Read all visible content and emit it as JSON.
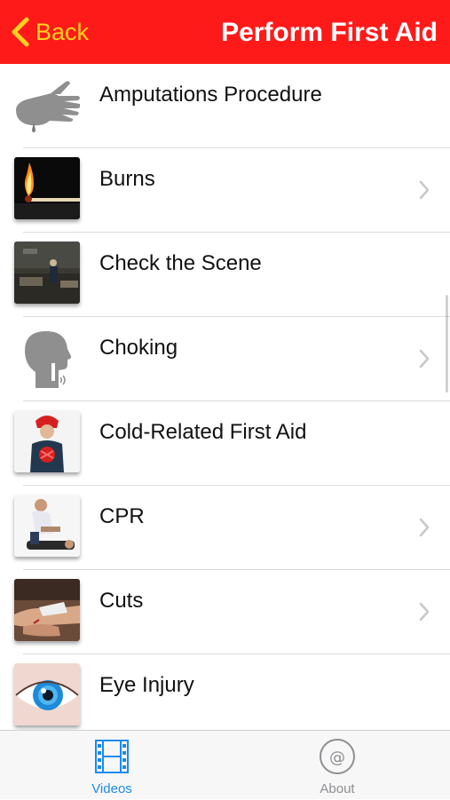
{
  "header": {
    "back_label": "Back",
    "title": "Perform First Aid"
  },
  "colors": {
    "nav_background": "#ff1a1a",
    "back_color": "#ffd21f",
    "tab_active": "#1a8bf0",
    "tab_inactive": "#8e8e93"
  },
  "list": {
    "items": [
      {
        "label": "Amputations Procedure",
        "icon": "hand-icon",
        "has_chevron": false
      },
      {
        "label": "Burns",
        "icon": "burning-match-icon",
        "has_chevron": true
      },
      {
        "label": "Check the Scene",
        "icon": "accident-scene-photo",
        "has_chevron": false
      },
      {
        "label": "Choking",
        "icon": "head-profile-icon",
        "has_chevron": true
      },
      {
        "label": "Cold-Related First Aid",
        "icon": "winter-person-photo",
        "has_chevron": false
      },
      {
        "label": "CPR",
        "icon": "cpr-photo",
        "has_chevron": true
      },
      {
        "label": "Cuts",
        "icon": "injured-hands-photo",
        "has_chevron": true
      },
      {
        "label": "Eye Injury",
        "icon": "eye-photo",
        "has_chevron": false
      }
    ]
  },
  "tabbar": {
    "tabs": [
      {
        "label": "Videos",
        "icon": "film-strip-icon",
        "active": true
      },
      {
        "label": "About",
        "icon": "at-sign-icon",
        "active": false
      }
    ]
  }
}
